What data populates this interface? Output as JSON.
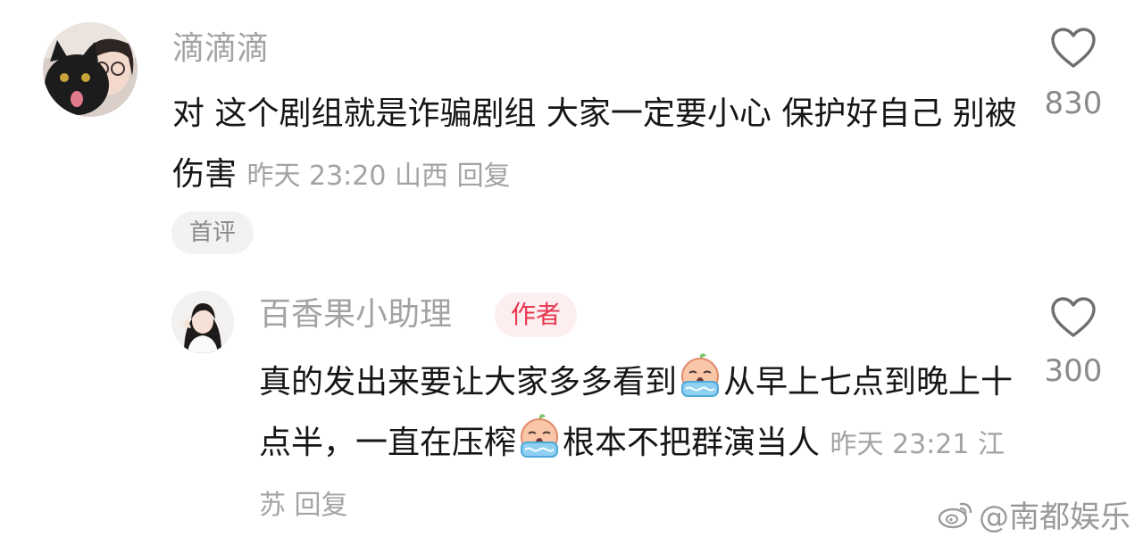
{
  "comments": [
    {
      "username": "滴滴滴",
      "text": "对 这个剧组就是诈骗剧组 大家一定要小心 保护好自己 别被伤害",
      "time": "昨天 23:20",
      "location": "山西",
      "reply_label": "回复",
      "likes": "830",
      "badge": "首评"
    },
    {
      "username": "百香果小助理",
      "author_badge": "作者",
      "text_part1": "真的发出来要让大家多多看到",
      "text_part2": "从早上七点到晚上十点半，一直在压榨",
      "text_part3": "根本不把群演当人",
      "time": "昨天 23:21",
      "location": "江苏",
      "reply_label": "回复",
      "likes": "300"
    }
  ],
  "watermark": {
    "text": "@南都娱乐",
    "icon": "weibo-icon"
  },
  "icons": {
    "like": "heart-outline-icon",
    "emoji": "crying-emoji-icon"
  },
  "colors": {
    "text": "#161616",
    "meta": "#a3a3a3",
    "author_badge_text": "#e8364f",
    "author_badge_bg": "#fdeef0"
  }
}
